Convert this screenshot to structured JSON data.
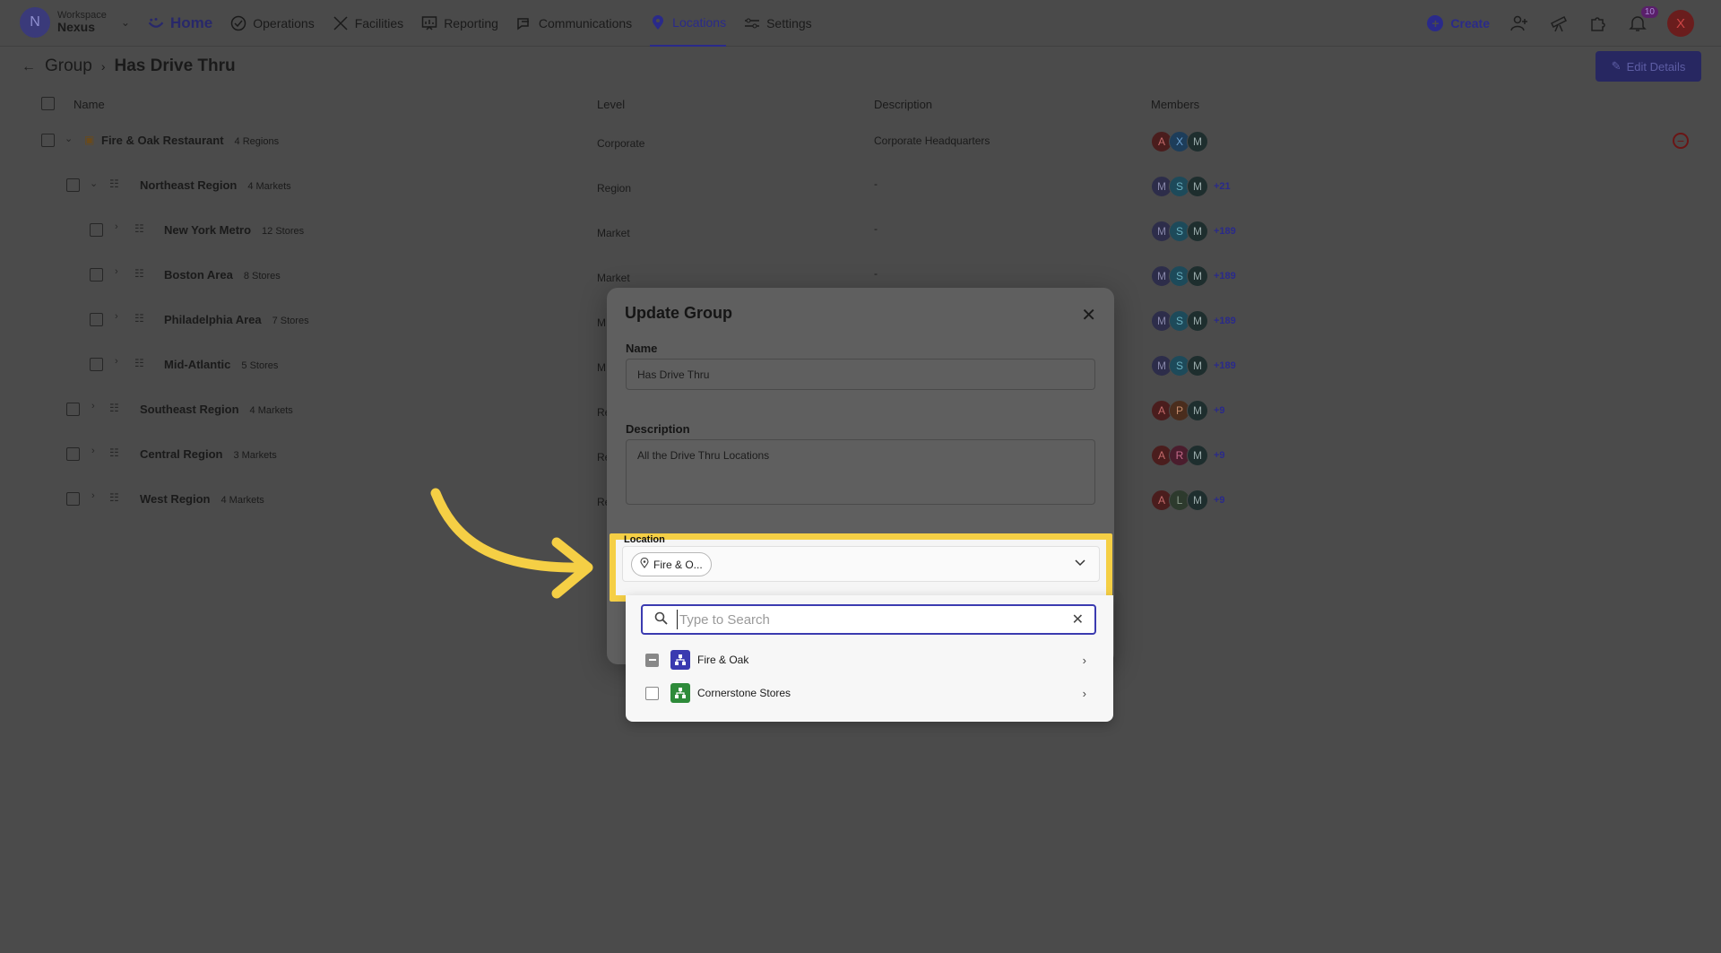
{
  "workspace": {
    "label": "Workspace",
    "name": "Nexus",
    "avatar_letter": "N"
  },
  "nav": [
    {
      "label": "Home",
      "icon": "home-icon"
    },
    {
      "label": "Operations",
      "icon": "check-circle-icon"
    },
    {
      "label": "Facilities",
      "icon": "tools-icon"
    },
    {
      "label": "Reporting",
      "icon": "chart-board-icon"
    },
    {
      "label": "Communications",
      "icon": "chat-icon"
    },
    {
      "label": "Locations",
      "icon": "pin-icon",
      "active": true
    },
    {
      "label": "Settings",
      "icon": "sliders-icon"
    }
  ],
  "header_tools": {
    "create_label": "Create",
    "notification_count": "10",
    "user_initial": "X"
  },
  "breadcrumb": {
    "parent": "Group",
    "current": "Has Drive Thru"
  },
  "edit_details_label": "Edit Details",
  "table": {
    "columns": [
      "Name",
      "Level",
      "Description",
      "Members"
    ],
    "rows": [
      {
        "name": "Fire & Oak Restaurant",
        "count": "4 Regions",
        "level": "Corporate",
        "description": "Corporate Headquarters",
        "members": [
          "A",
          "X",
          "M"
        ],
        "extra": ""
      },
      {
        "name": "Northeast Region",
        "count": "4 Markets",
        "level": "Region",
        "description": "-",
        "members": [
          "M",
          "S",
          "M"
        ],
        "extra": "+21"
      },
      {
        "name": "New York Metro",
        "count": "12 Stores",
        "level": "Market",
        "description": "-",
        "members": [
          "M",
          "S",
          "M"
        ],
        "extra": "+189"
      },
      {
        "name": "Boston Area",
        "count": "8 Stores",
        "level": "Market",
        "description": "-",
        "members": [
          "M",
          "S",
          "M"
        ],
        "extra": "+189"
      },
      {
        "name": "Philadelphia Area",
        "count": "7 Stores",
        "level": "M",
        "description": "",
        "members": [
          "M",
          "S",
          "M"
        ],
        "extra": "+189"
      },
      {
        "name": "Mid-Atlantic",
        "count": "5 Stores",
        "level": "M",
        "description": "",
        "members": [
          "M",
          "S",
          "M"
        ],
        "extra": "+189"
      },
      {
        "name": "Southeast Region",
        "count": "4 Markets",
        "level": "Re",
        "description": "",
        "members": [
          "A",
          "P",
          "M"
        ],
        "extra": "+9"
      },
      {
        "name": "Central Region",
        "count": "3 Markets",
        "level": "Re",
        "description": "",
        "members": [
          "A",
          "R",
          "M"
        ],
        "extra": "+9"
      },
      {
        "name": "West Region",
        "count": "4 Markets",
        "level": "Re",
        "description": "",
        "members": [
          "A",
          "L",
          "M"
        ],
        "extra": "+9"
      }
    ]
  },
  "modal": {
    "title": "Update Group",
    "name_label": "Name",
    "name_value": "Has Drive Thru",
    "description_label": "Description",
    "description_value": "All the Drive Thru Locations",
    "location_label": "Location",
    "location_chip": "Fire & O..."
  },
  "dropdown": {
    "search_placeholder": "Type to Search",
    "options": [
      {
        "label": "Fire & Oak",
        "state": "partial",
        "color": "#3a3ab0"
      },
      {
        "label": "Cornerstone Stores",
        "state": "unchecked",
        "color": "#2e8b3a"
      }
    ]
  },
  "colors": {
    "accent": "#2a2a8a",
    "highlight": "#f5cf45"
  }
}
